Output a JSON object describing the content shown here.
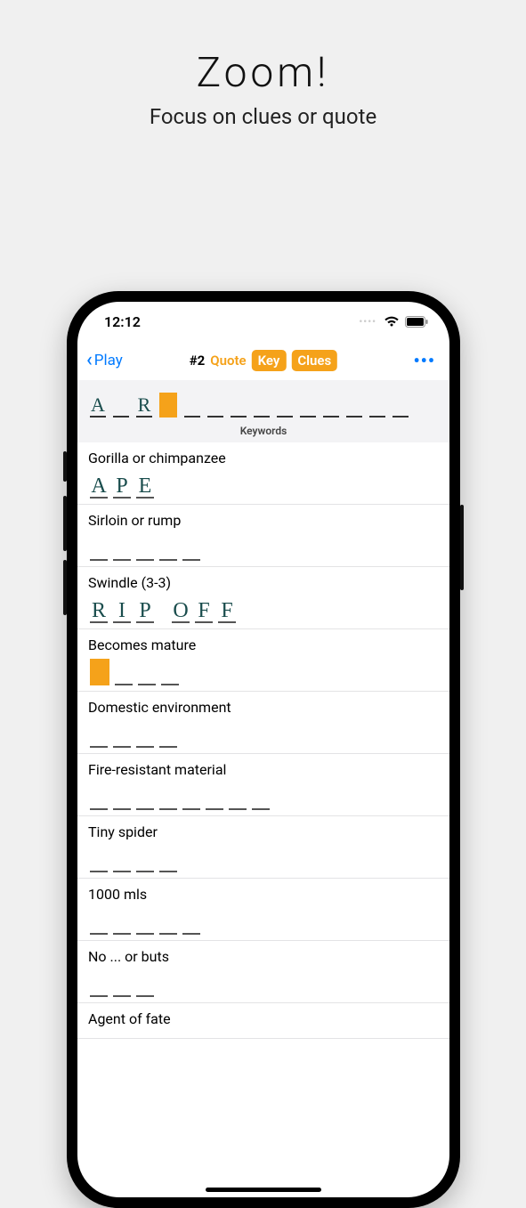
{
  "promo": {
    "title": "Zoom!",
    "subtitle": "Focus on clues or quote"
  },
  "status": {
    "time": "12:12"
  },
  "nav": {
    "back_label": "Play",
    "puzzle_number": "#2",
    "tab_quote": "Quote",
    "tab_key": "Key",
    "tab_clues": "Clues",
    "more": "•••"
  },
  "key_section": {
    "label": "Keywords",
    "slots": [
      {
        "letter": "A",
        "cursor": false
      },
      {
        "letter": "",
        "cursor": false
      },
      {
        "letter": "R",
        "cursor": false
      },
      {
        "letter": "",
        "cursor": true
      },
      {
        "letter": "",
        "cursor": false
      },
      {
        "letter": "",
        "cursor": false
      },
      {
        "letter": "",
        "cursor": false
      },
      {
        "letter": "",
        "cursor": false
      },
      {
        "letter": "",
        "cursor": false
      },
      {
        "letter": "",
        "cursor": false
      },
      {
        "letter": "",
        "cursor": false
      },
      {
        "letter": "",
        "cursor": false
      },
      {
        "letter": "",
        "cursor": false
      },
      {
        "letter": "",
        "cursor": false
      }
    ]
  },
  "clues": [
    {
      "text": "Gorilla or chimpanzee",
      "answer": [
        "A",
        "P",
        "E"
      ],
      "cursor_index": -1
    },
    {
      "text": "Sirloin or rump",
      "answer": [
        "",
        "",
        "",
        "",
        ""
      ],
      "cursor_index": -1
    },
    {
      "text": "Swindle (3-3)",
      "answer": [
        "R",
        "I",
        "P",
        " ",
        "O",
        "F",
        "F"
      ],
      "cursor_index": -1
    },
    {
      "text": "Becomes mature",
      "answer": [
        "",
        "",
        "",
        ""
      ],
      "cursor_index": 0
    },
    {
      "text": "Domestic environment",
      "answer": [
        "",
        "",
        "",
        ""
      ],
      "cursor_index": -1
    },
    {
      "text": "Fire-resistant material",
      "answer": [
        "",
        "",
        "",
        "",
        "",
        "",
        "",
        ""
      ],
      "cursor_index": -1
    },
    {
      "text": "Tiny spider",
      "answer": [
        "",
        "",
        "",
        ""
      ],
      "cursor_index": -1
    },
    {
      "text": "1000 mls",
      "answer": [
        "",
        "",
        "",
        "",
        ""
      ],
      "cursor_index": -1
    },
    {
      "text": "No ... or buts",
      "answer": [
        "",
        "",
        ""
      ],
      "cursor_index": -1
    },
    {
      "text": "Agent of fate",
      "answer": [],
      "cursor_index": -1
    }
  ]
}
